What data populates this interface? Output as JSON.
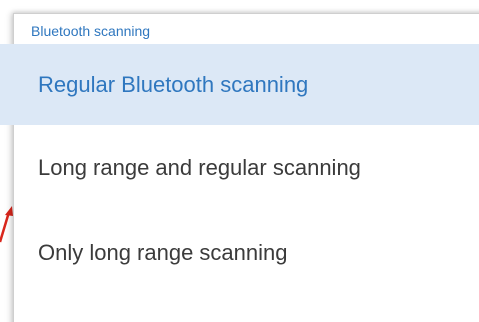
{
  "dropdown": {
    "label": "Bluetooth scanning",
    "selected_index": 0,
    "options": [
      {
        "label": "Regular Bluetooth scanning",
        "selected": true
      },
      {
        "label": "Long range and regular scanning",
        "selected": false
      },
      {
        "label": "Only long range scanning",
        "selected": false
      }
    ]
  },
  "colors": {
    "accent": "#2f77bf",
    "selected_background": "#dce8f6",
    "text": "#3b3b3b",
    "annotation": "#d9261c"
  }
}
